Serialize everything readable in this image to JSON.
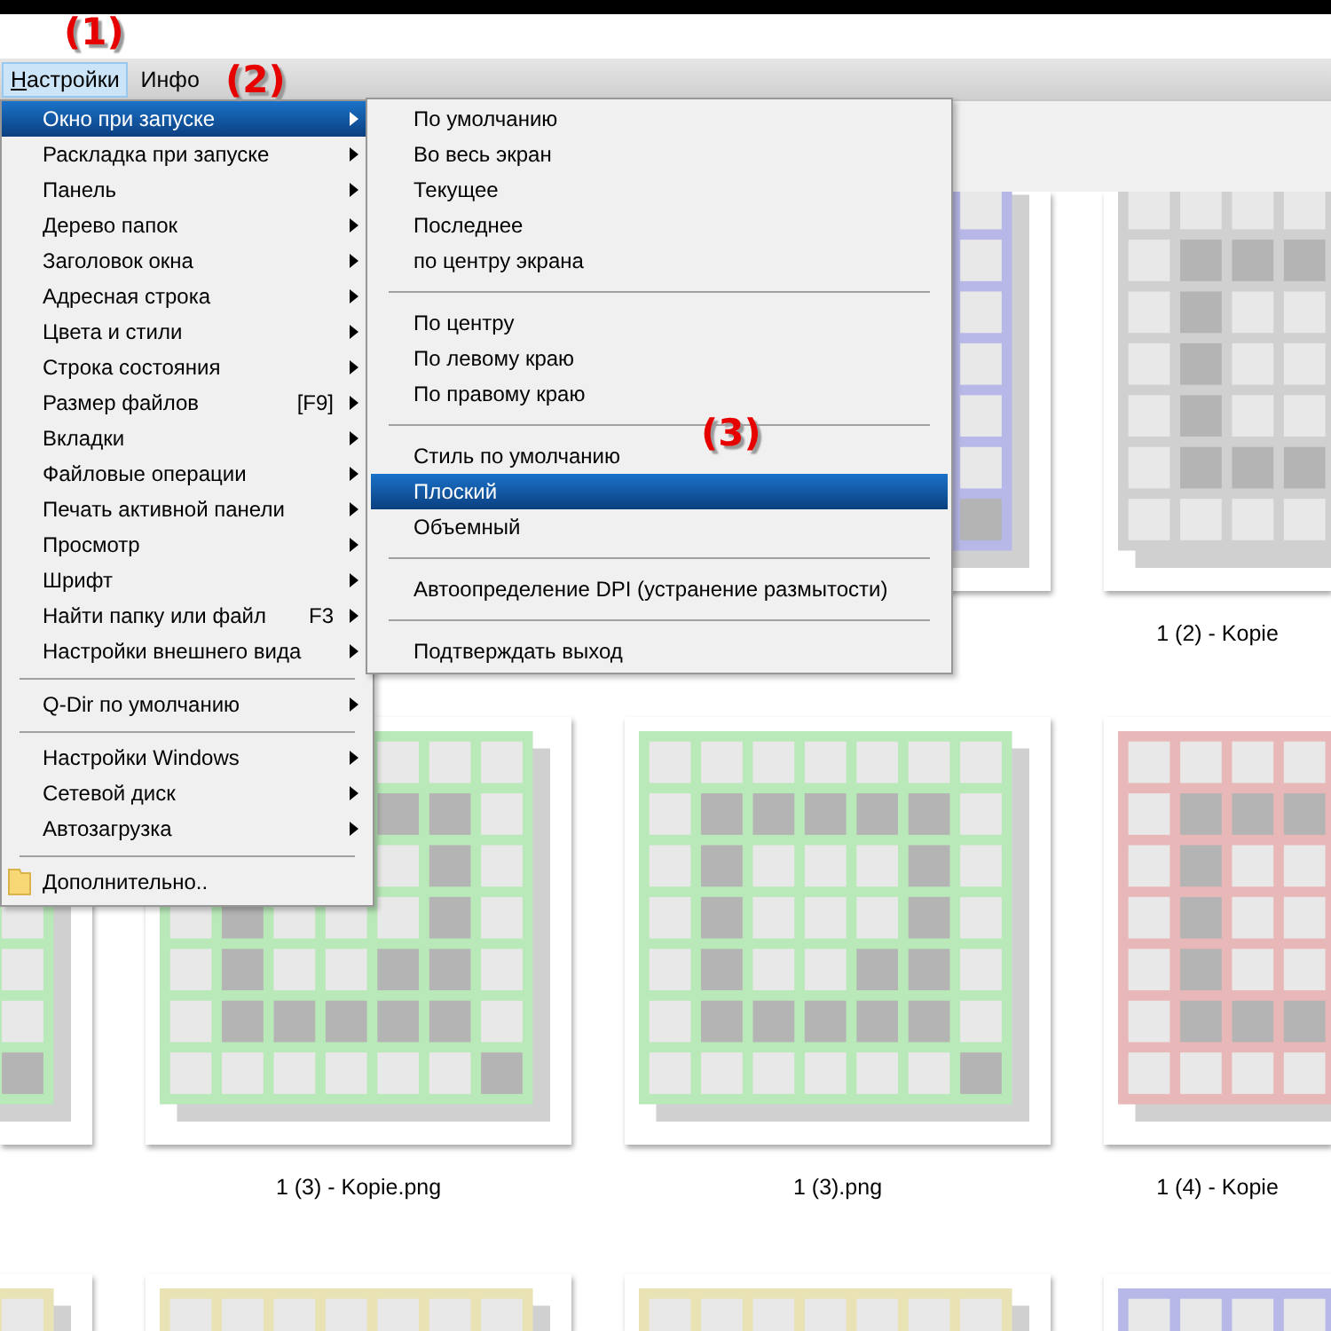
{
  "menubar": [
    {
      "label": "Настройки",
      "selected": true,
      "mnemonic": true
    },
    {
      "label": "Инфо",
      "selected": false,
      "mnemonic": false
    }
  ],
  "main_menu": [
    {
      "kind": "item",
      "label": "Окно при запуске",
      "selected": true,
      "submenu": true
    },
    {
      "kind": "item",
      "label": "Раскладка при запуске",
      "selected": false,
      "submenu": true
    },
    {
      "kind": "item",
      "label": "Панель",
      "selected": false,
      "submenu": true
    },
    {
      "kind": "item",
      "label": "Дерево папок",
      "selected": false,
      "submenu": true
    },
    {
      "kind": "item",
      "label": "Заголовок окна",
      "selected": false,
      "submenu": true
    },
    {
      "kind": "item",
      "label": "Адресная строка",
      "selected": false,
      "submenu": true
    },
    {
      "kind": "item",
      "label": "Цвета и стили",
      "selected": false,
      "submenu": true
    },
    {
      "kind": "item",
      "label": "Строка состояния",
      "selected": false,
      "submenu": true
    },
    {
      "kind": "item",
      "label": "Размер файлов",
      "shortcut": "[F9]",
      "selected": false,
      "submenu": true
    },
    {
      "kind": "item",
      "label": "Вкладки",
      "selected": false,
      "submenu": true
    },
    {
      "kind": "item",
      "label": "Файловые операции",
      "selected": false,
      "submenu": true
    },
    {
      "kind": "item",
      "label": "Печать активной панели",
      "selected": false,
      "submenu": true
    },
    {
      "kind": "item",
      "label": "Просмотр",
      "selected": false,
      "submenu": true
    },
    {
      "kind": "item",
      "label": "Шрифт",
      "selected": false,
      "submenu": true
    },
    {
      "kind": "item",
      "label": "Найти папку или файл",
      "shortcut": "F3",
      "selected": false,
      "submenu": true
    },
    {
      "kind": "item",
      "label": "Настройки внешнего вида",
      "selected": false,
      "submenu": true
    },
    {
      "kind": "separator"
    },
    {
      "kind": "item",
      "label": "Q-Dir по умолчанию",
      "selected": false,
      "submenu": true
    },
    {
      "kind": "separator"
    },
    {
      "kind": "item",
      "label": "Настройки Windows",
      "selected": false,
      "submenu": true
    },
    {
      "kind": "item",
      "label": "Сетевой диск",
      "selected": false,
      "submenu": true
    },
    {
      "kind": "item",
      "label": "Автозагрузка",
      "selected": false,
      "submenu": true
    },
    {
      "kind": "separator"
    },
    {
      "kind": "icon_item",
      "label": "Дополнительно..",
      "selected": false,
      "submenu": false
    }
  ],
  "submenu": [
    {
      "kind": "item",
      "label": "По умолчанию",
      "selected": false
    },
    {
      "kind": "item",
      "label": "Во весь экран",
      "selected": false
    },
    {
      "kind": "item",
      "label": "Текущее",
      "selected": false
    },
    {
      "kind": "item",
      "label": "Последнее",
      "selected": false
    },
    {
      "kind": "item",
      "label": "по центру экрана",
      "selected": false
    },
    {
      "kind": "separator"
    },
    {
      "kind": "item",
      "label": "По центру",
      "selected": false
    },
    {
      "kind": "item",
      "label": "По левому краю",
      "selected": false
    },
    {
      "kind": "item",
      "label": "По правому краю",
      "selected": false
    },
    {
      "kind": "separator"
    },
    {
      "kind": "item",
      "label": "Стиль по умолчанию",
      "selected": false
    },
    {
      "kind": "item",
      "label": "Плоский",
      "selected": true
    },
    {
      "kind": "item",
      "label": "Объемный",
      "selected": false
    },
    {
      "kind": "separator"
    },
    {
      "kind": "item",
      "label": "Автоопределение DPI (устранение размытости)",
      "selected": false
    },
    {
      "kind": "separator"
    },
    {
      "kind": "item",
      "label": "Подтверждать выход",
      "selected": false
    }
  ],
  "thumbnail_rows": [
    {
      "tiles": [
        {
          "color": "#b8b8e8"
        },
        {
          "color": "#d0d0d0",
          "label": "1 (2) - Kopie"
        }
      ]
    },
    {
      "tiles": [
        {
          "color": "#b9e8b9"
        },
        {
          "color": "#b9e8b9",
          "label": "1 (3) - Kopie.png"
        },
        {
          "color": "#b9e8b9",
          "label": "1 (3).png"
        },
        {
          "color": "#e8b8b8",
          "label": "1 (4) - Kopie"
        }
      ]
    },
    {
      "tiles": [
        {
          "color": "#e8e2b4"
        },
        {
          "color": "#e8e2b4"
        },
        {
          "color": "#e8e2b4"
        },
        {
          "color": "#b8b8e8"
        }
      ]
    }
  ],
  "annotations": [
    {
      "label": "(1)",
      "kind": "menubar"
    },
    {
      "label": "(2)",
      "kind": "info"
    },
    {
      "label": "(3)",
      "kind": "submenu"
    }
  ]
}
